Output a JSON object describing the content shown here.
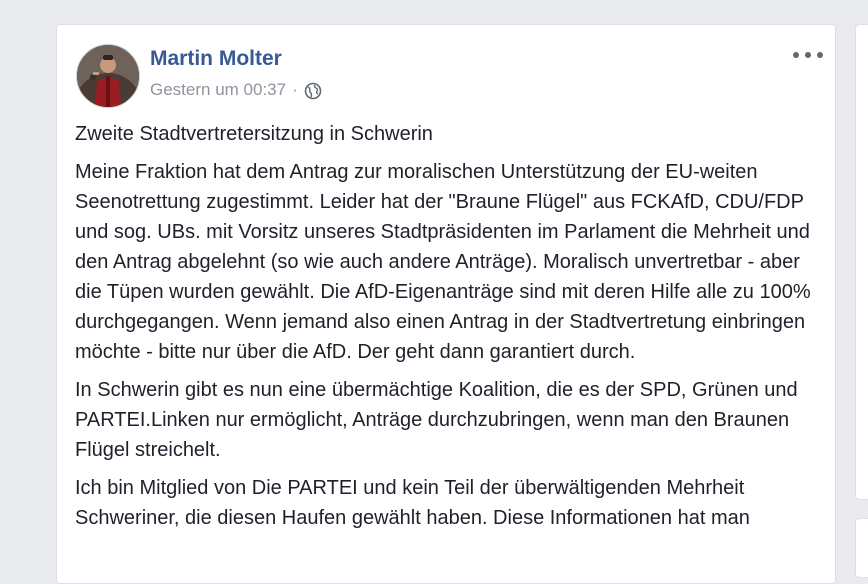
{
  "post": {
    "author": "Martin Molter",
    "timestamp": "Gestern um 00:37",
    "separator": "·",
    "privacy_icon": "globe-icon",
    "more_icon": "more-options-icon",
    "paragraphs": [
      "Zweite Stadtvertretersitzung in Schwerin",
      "Meine Fraktion hat dem Antrag zur moralischen Unterstützung der EU-weiten Seenotrettung zugestimmt. Leider hat der \"Braune Flügel\" aus FCKAfD, CDU/FDP und sog. UBs. mit Vorsitz unseres Stadtpräsidenten im Parlament die Mehrheit und den Antrag abgelehnt (so wie auch andere Anträge). Moralisch unvertretbar - aber die Tüpen wurden gewählt. Die AfD-Eigenanträge sind mit deren Hilfe alle zu 100% durchgegangen. Wenn jemand also einen Antrag in der Stadtvertretung einbringen möchte - bitte nur über die AfD. Der geht dann garantiert durch.",
      "In Schwerin gibt es nun eine übermächtige Koalition, die es der SPD, Grünen und PARTEI.Linken nur ermöglicht, Anträge durchzubringen, wenn man den Braunen Flügel streichelt.",
      "Ich bin Mitglied von Die PARTEI und kein Teil der überwältigenden Mehrheit Schweriner, die diesen Haufen gewählt haben. Diese Informationen hat man"
    ]
  },
  "colors": {
    "author_link": "#385898",
    "meta_gray": "#90949c",
    "body_text": "#1d2129",
    "background": "#e9ebee"
  }
}
